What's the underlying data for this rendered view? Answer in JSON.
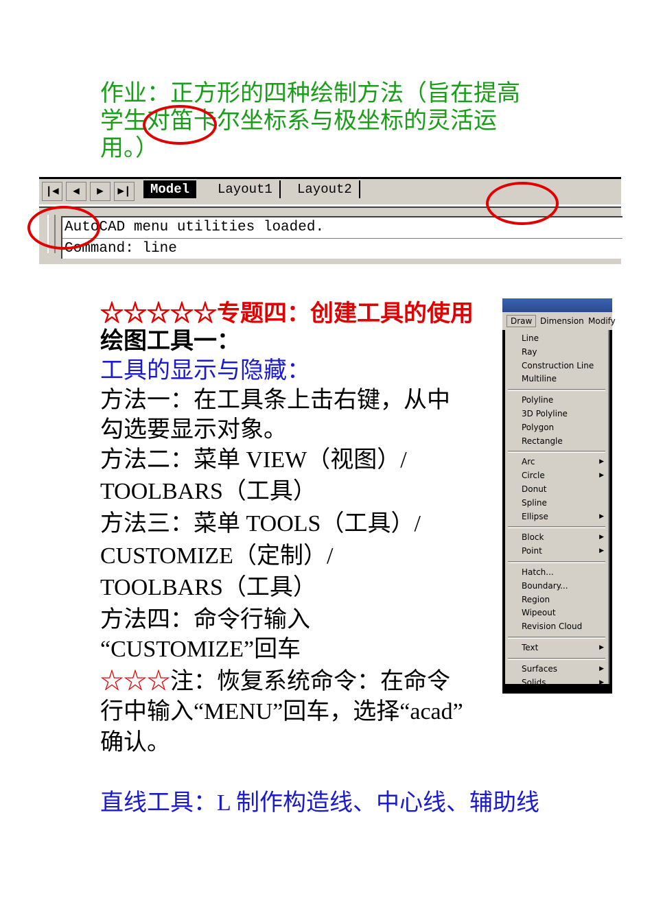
{
  "homework": {
    "line1": "作业：正方形的四种绘制方法（旨在提高",
    "line2": "学生对笛卡尔坐标系与极坐标的灵活运",
    "line3": "用。）"
  },
  "cad": {
    "nav": [
      "|◀",
      "◀",
      "▶",
      "▶|"
    ],
    "tabs": [
      "Model",
      "Layout1",
      "Layout2"
    ],
    "command_lines": [
      "AutoCAD menu utilities loaded.",
      "Command: line"
    ]
  },
  "lines": [
    {
      "text": "☆☆☆☆☆专题四：创建工具的使用",
      "style": "red"
    },
    {
      "text": "绘图工具一：",
      "style": "bold"
    },
    {
      "text": "工具的显示与隐藏：",
      "style": "blue"
    },
    {
      "text": "方法一：在工具条上击右键，从中",
      "style": ""
    },
    {
      "text": "勾选要显示对象。",
      "style": ""
    },
    {
      "text": "方法二：菜单 VIEW（视图）/",
      "style": ""
    },
    {
      "text": "TOOLBARS（工具）",
      "style": ""
    },
    {
      "text": "方法三：菜单 TOOLS（工具）/",
      "style": ""
    },
    {
      "text": "CUSTOMIZE（定制）/",
      "style": ""
    },
    {
      "text": "TOOLBARS（工具）",
      "style": ""
    },
    {
      "text": "方法四：命令行输入",
      "style": ""
    },
    {
      "text": "“CUSTOMIZE”回车",
      "style": ""
    },
    {
      "text": "注：恢复系统命令：在命令",
      "stars": "☆☆☆",
      "style": ""
    },
    {
      "text": "行中输入“MENU”回车，选择“acad”",
      "style": ""
    },
    {
      "text": "确认。",
      "style": ""
    }
  ],
  "footer": "直线工具：L 制作构造线、中心线、辅助线",
  "menu": {
    "bar": [
      "Draw",
      "Dimension",
      "Modify"
    ],
    "groups": [
      [
        {
          "label": "Line"
        },
        {
          "label": "Ray"
        },
        {
          "label": "Construction Line"
        },
        {
          "label": "Multiline"
        }
      ],
      [
        {
          "label": "Polyline"
        },
        {
          "label": "3D Polyline"
        },
        {
          "label": "Polygon"
        },
        {
          "label": "Rectangle"
        }
      ],
      [
        {
          "label": "Arc",
          "sub": true
        },
        {
          "label": "Circle",
          "sub": true
        },
        {
          "label": "Donut"
        },
        {
          "label": "Spline"
        },
        {
          "label": "Ellipse",
          "sub": true
        }
      ],
      [
        {
          "label": "Block",
          "sub": true
        },
        {
          "label": "Point",
          "sub": true
        }
      ],
      [
        {
          "label": "Hatch..."
        },
        {
          "label": "Boundary..."
        },
        {
          "label": "Region"
        },
        {
          "label": "Wipeout"
        },
        {
          "label": "Revision Cloud"
        }
      ],
      [
        {
          "label": "Text",
          "sub": true
        }
      ],
      [
        {
          "label": "Surfaces",
          "sub": true
        },
        {
          "label": "Solids",
          "sub": true
        }
      ]
    ]
  }
}
